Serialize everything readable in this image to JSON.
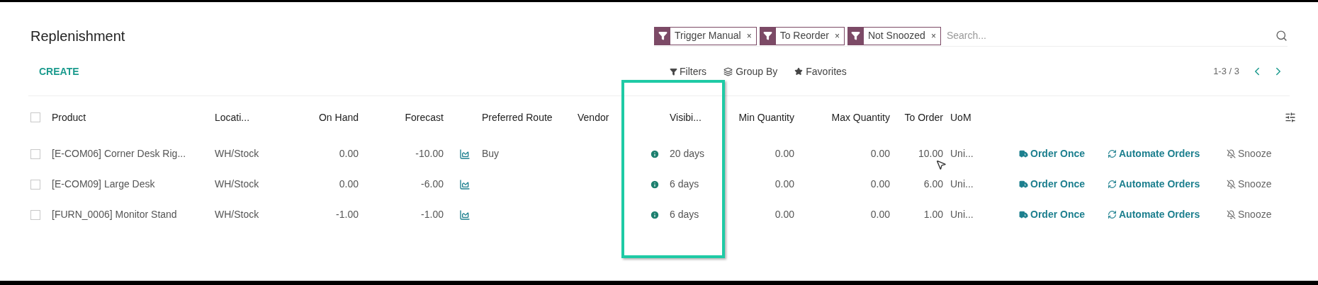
{
  "title": "Replenishment",
  "create_button": "CREATE",
  "facets": [
    {
      "label": "Trigger Manual",
      "remove": "×"
    },
    {
      "label": "To Reorder",
      "remove": "×"
    },
    {
      "label": "Not Snoozed",
      "remove": "×"
    }
  ],
  "search": {
    "placeholder": "Search..."
  },
  "toolbar": {
    "filters": "Filters",
    "group_by": "Group By",
    "favorites": "Favorites",
    "pager": "1-3 / 3"
  },
  "select_all": {
    "checked": false
  },
  "columns": [
    "Product",
    "Locati...",
    "On Hand",
    "Forecast",
    "Preferred Route",
    "Vendor",
    "Visibi...",
    "Min Quantity",
    "Max Quantity",
    "To Order",
    "UoM"
  ],
  "rows": [
    {
      "checked": false,
      "product": "[E-COM06] Corner Desk Rig...",
      "location": "WH/Stock",
      "on_hand": "0.00",
      "forecast": "-10.00",
      "route": "Buy",
      "visibility": "20 days",
      "min_qty": "0.00",
      "max_qty": "0.00",
      "to_order": "10.00",
      "uom": "Uni...",
      "actions": [
        "Order Once",
        "Automate Orders",
        "Snooze"
      ]
    },
    {
      "checked": false,
      "product": "[E-COM09] Large Desk",
      "location": "WH/Stock",
      "on_hand": "0.00",
      "forecast": "-6.00",
      "visibility": "6 days",
      "min_qty": "0.00",
      "max_qty": "0.00",
      "to_order": "6.00",
      "uom": "Uni...",
      "actions": [
        "Order Once",
        "Automate Orders",
        "Snooze"
      ]
    },
    {
      "checked": false,
      "product": "[FURN_0006] Monitor Stand",
      "location": "WH/Stock",
      "on_hand": "-1.00",
      "forecast": "-1.00",
      "visibility": "6 days",
      "min_qty": "0.00",
      "max_qty": "0.00",
      "to_order": "1.00",
      "uom": "Uni...",
      "actions": [
        "Order Once",
        "Automate Orders",
        "Snooze"
      ]
    }
  ]
}
